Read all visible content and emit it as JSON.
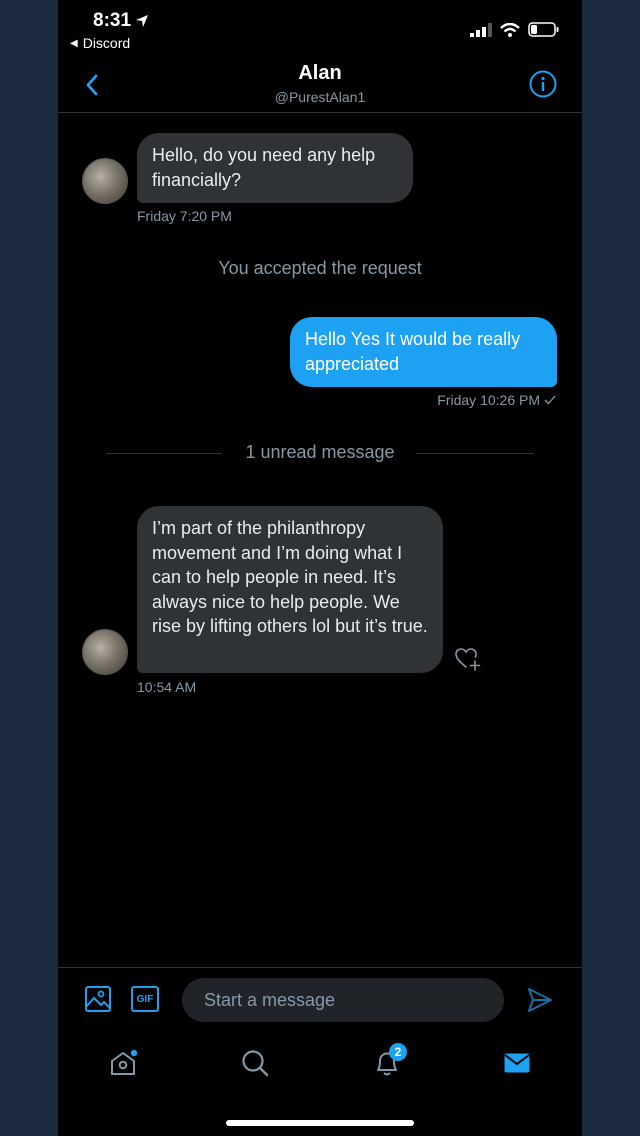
{
  "status_bar": {
    "time": "8:31",
    "back_app": "Discord"
  },
  "header": {
    "name": "Alan",
    "handle": "@PurestAlan1"
  },
  "messages": [
    {
      "direction": "incoming",
      "text": "Hello, do you need any help financially?",
      "timestamp": "Friday 7:20 PM"
    },
    {
      "direction": "system",
      "text": "You accepted the request"
    },
    {
      "direction": "outgoing",
      "text": "Hello Yes It would be really appreciated",
      "timestamp": "Friday 10:26 PM"
    },
    {
      "direction": "divider",
      "text": "1 unread message"
    },
    {
      "direction": "incoming",
      "text": "I’m part of the philanthropy movement and I’m doing what I can to help people in need. It’s always nice to help people. We rise by lifting others lol but it’s true.",
      "timestamp": "10:54 AM"
    }
  ],
  "composer": {
    "placeholder": "Start a message",
    "gif_label": "GIF"
  },
  "tabbar": {
    "notifications_count": "2"
  },
  "colors": {
    "accent": "#1da1f2",
    "background": "#000000",
    "bubble_incoming": "#2f3336",
    "muted_text": "#8899a6"
  }
}
